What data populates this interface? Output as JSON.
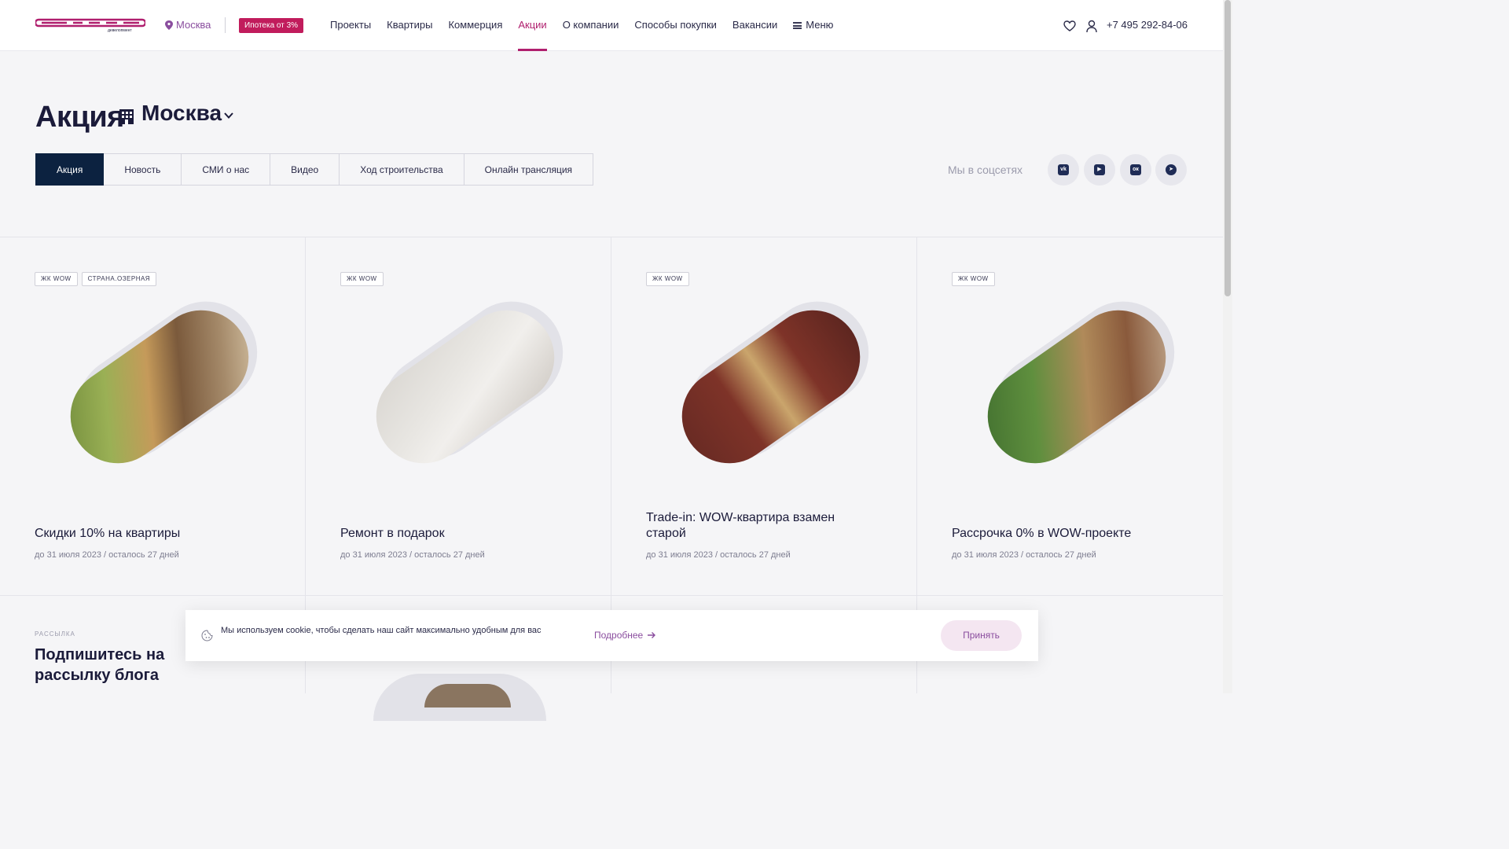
{
  "header": {
    "logo_text": "СТРАНА девелопмент",
    "city": "Москва",
    "promo": "Ипотека от 3%",
    "nav": [
      "Проекты",
      "Квартиры",
      "Коммерция",
      "Акции",
      "О компании",
      "Способы покупки",
      "Вакансии",
      "Меню"
    ],
    "active_nav": "Акции",
    "phone": "+7 495 292-84-06"
  },
  "page": {
    "title": "Акция",
    "city": "Москва"
  },
  "tabs": [
    "Акция",
    "Новость",
    "СМИ о нас",
    "Видео",
    "Ход строительства",
    "Онлайн трансляция"
  ],
  "active_tab": "Акция",
  "social": {
    "label": "Мы в соцсетях",
    "icons": [
      "vk-icon",
      "youtube-icon",
      "odnoklassniki-icon",
      "telegram-icon"
    ]
  },
  "cards": [
    {
      "tags": [
        "ЖК WOW",
        "СТРАНА.ОЗЕРНАЯ"
      ],
      "title": "Скидки 10% на квартиры",
      "meta": "до 31 июля 2023 / осталось 27 дней"
    },
    {
      "tags": [
        "ЖК WOW"
      ],
      "title": "Ремонт в подарок",
      "meta": "до 31 июля 2023 / осталось 27 дней"
    },
    {
      "tags": [
        "ЖК WOW"
      ],
      "title": "Trade-in: WOW-квартира взамен старой",
      "meta": "до 31 июля 2023 / осталось 27 дней"
    },
    {
      "tags": [
        "ЖК WOW"
      ],
      "title": "Рассрочка 0% в WOW-проекте",
      "meta": "до 31 июля 2023 / осталось 27 дней"
    }
  ],
  "subscribe": {
    "label": "РАССЫЛКА",
    "title": "Подпишитесь на рассылку блога"
  },
  "cookie": {
    "text": "Мы используем cookie, чтобы сделать наш сайт максимально удобным для вас",
    "more": "Подробнее",
    "accept": "Принять"
  },
  "colors": {
    "accent": "#b01f6e",
    "promo": "#c11c5c",
    "dark": "#0c2240"
  }
}
